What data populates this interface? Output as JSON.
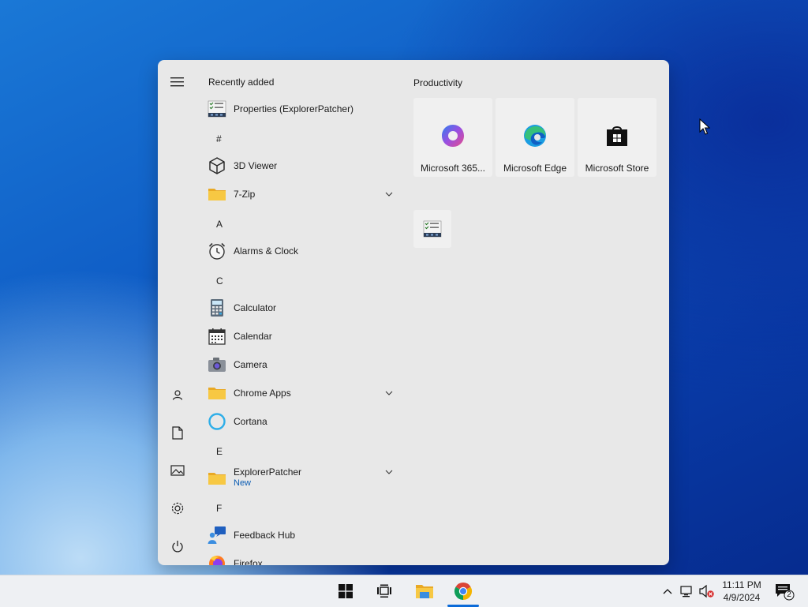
{
  "start_menu": {
    "recently_added_header": "Recently added",
    "productivity_header": "Productivity",
    "apps": {
      "recent_properties": "Properties (ExplorerPatcher)",
      "letter_hash": "#",
      "viewer_3d": "3D Viewer",
      "zip": "7-Zip",
      "letter_a": "A",
      "alarms": "Alarms & Clock",
      "letter_c": "C",
      "calculator": "Calculator",
      "calendar": "Calendar",
      "camera": "Camera",
      "chrome_apps": "Chrome Apps",
      "cortana": "Cortana",
      "letter_e": "E",
      "explorer_patcher": "ExplorerPatcher",
      "explorer_patcher_badge": "New",
      "letter_f": "F",
      "feedback_hub": "Feedback Hub",
      "firefox": "Firefox"
    },
    "tiles": {
      "m365": "Microsoft 365...",
      "edge": "Microsoft Edge",
      "store": "Microsoft Store"
    }
  },
  "taskbar": {
    "clock_time": "11:11 PM",
    "clock_date": "4/9/2024",
    "notification_count": "2"
  },
  "icons": {
    "start": "windows-logo-icon",
    "task_view": "task-view-icon",
    "file_explorer": "folder-icon",
    "chrome": "chrome-icon"
  },
  "colors": {
    "accent": "#0a6ad8",
    "menu_bg": "#e8e8e8",
    "new_badge": "#0a5cb3"
  }
}
